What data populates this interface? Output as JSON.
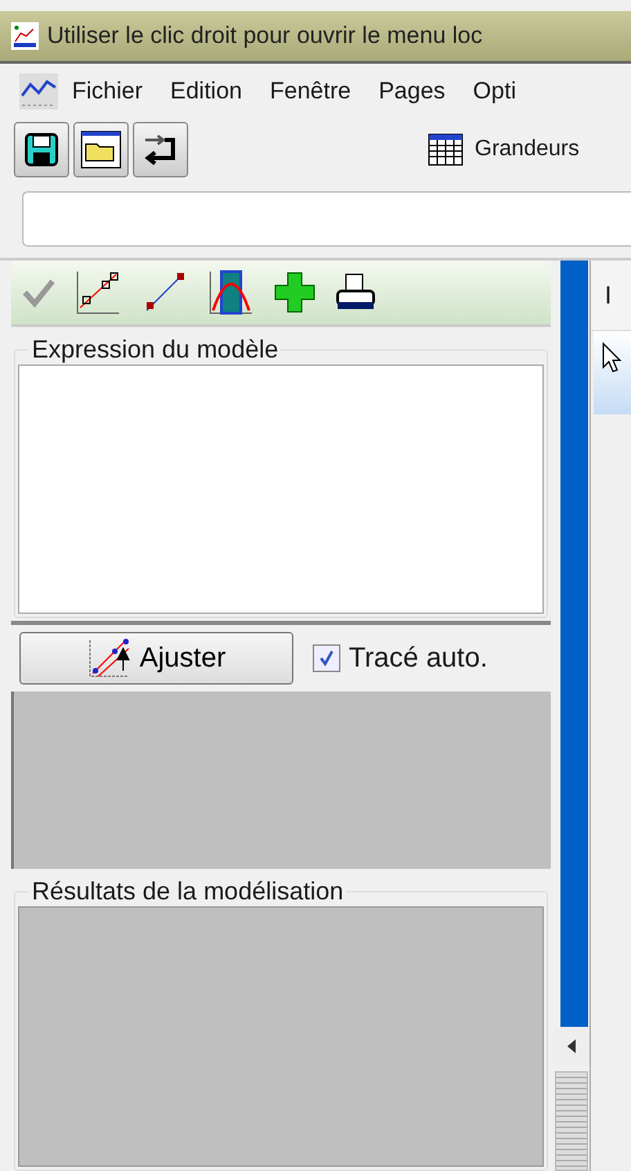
{
  "window": {
    "title": "Utiliser le clic droit pour ouvrir le menu loc"
  },
  "menu": [
    "Fichier",
    "Edition",
    "Fenêtre",
    "Pages",
    "Opti"
  ],
  "toolbar": {
    "grandeurs_label": "Grandeurs"
  },
  "model_panel": {
    "expression_title": "Expression du modèle",
    "fit_button": "Ajuster",
    "auto_plot": {
      "label": "Tracé auto.",
      "checked": true
    },
    "results_title": "Résultats de la modélisation"
  },
  "right_panel": {
    "column_header": "I"
  }
}
